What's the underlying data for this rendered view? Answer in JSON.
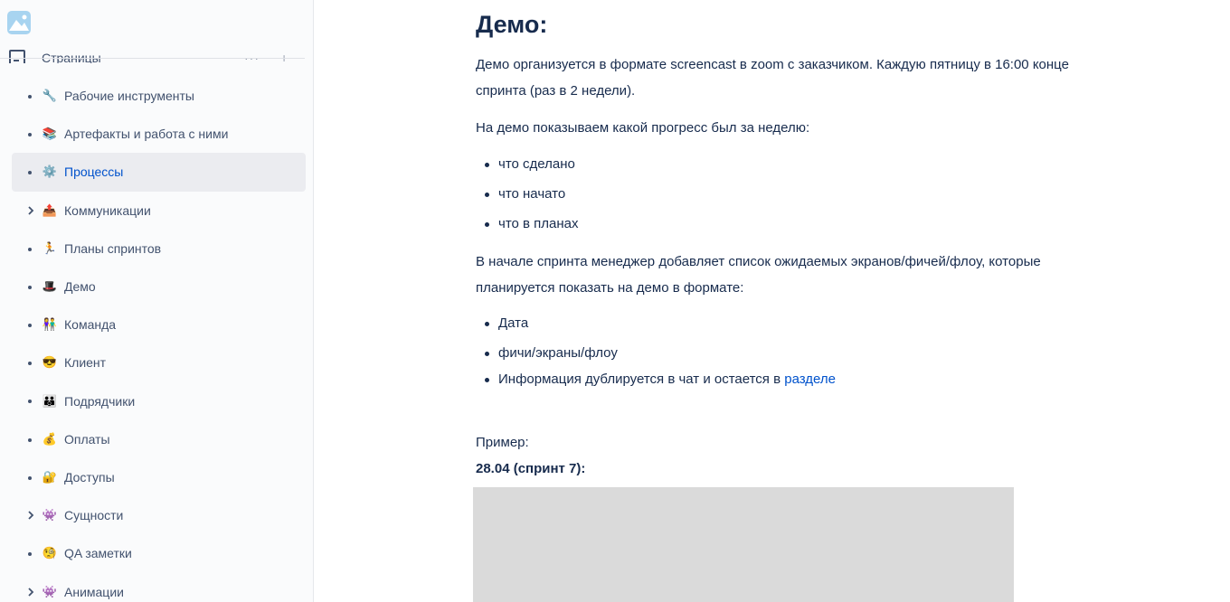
{
  "sidebar": {
    "logo_icon": "space-logo-icon",
    "pages_header": {
      "label": "Страницы",
      "icon": "pages-icon",
      "more": "···",
      "add": "+"
    },
    "items": [
      {
        "emoji": "🔧",
        "label": "Рабочие инструменты",
        "expandable": false,
        "active": false
      },
      {
        "emoji": "📚",
        "label": "Артефакты и работа с ними",
        "expandable": false,
        "active": false
      },
      {
        "emoji": "⚙️",
        "label": "Процессы",
        "expandable": false,
        "active": true
      },
      {
        "emoji": "📤",
        "label": "Коммуникации",
        "expandable": true,
        "active": false
      },
      {
        "emoji": "🏃",
        "label": "Планы спринтов",
        "expandable": false,
        "active": false
      },
      {
        "emoji": "🎩",
        "label": "Демо",
        "expandable": false,
        "active": false
      },
      {
        "emoji": "👫",
        "label": "Команда",
        "expandable": false,
        "active": false
      },
      {
        "emoji": "😎",
        "label": "Клиент",
        "expandable": false,
        "active": false
      },
      {
        "emoji": "👪",
        "label": "Подрядчики",
        "expandable": false,
        "active": false
      },
      {
        "emoji": "💰",
        "label": "Оплаты",
        "expandable": false,
        "active": false
      },
      {
        "emoji": "🔐",
        "label": "Доступы",
        "expandable": false,
        "active": false
      },
      {
        "emoji": "👾",
        "label": "Сущности",
        "expandable": true,
        "active": false
      },
      {
        "emoji": "🧐",
        "label": "QA заметки",
        "expandable": false,
        "active": false
      },
      {
        "emoji": "👾",
        "label": "Анимации",
        "expandable": true,
        "active": false
      }
    ]
  },
  "content": {
    "title": "Демо:",
    "para1_line1": "Демо организуется в формате screencast в zoom с заказчиком. Каждую пятницу в 16:00 конце",
    "para1_line2": "спринта (раз в 2 недели).",
    "para2": "На демо показываем какой прогресс был за неделю:",
    "list1": [
      "что сделано",
      "что начато",
      "что в планах"
    ],
    "para3_line1": "В начале спринта менеджер добавляет список ожидаемых экранов/фичей/флоу, которые",
    "para3_line2": "планируется показать на демо в формате:",
    "list2": [
      "Дата",
      "фичи/экраны/флоу"
    ],
    "info_text": "Информация дублируется в чат и остается в ",
    "info_link": "разделе",
    "example_label": "Пример:",
    "example_date": "28.04 (спринт 7):"
  },
  "colors": {
    "link": "#0052cc",
    "text": "#172b4d",
    "active_bg": "#ebecf0",
    "image_placeholder": "#dadada"
  }
}
